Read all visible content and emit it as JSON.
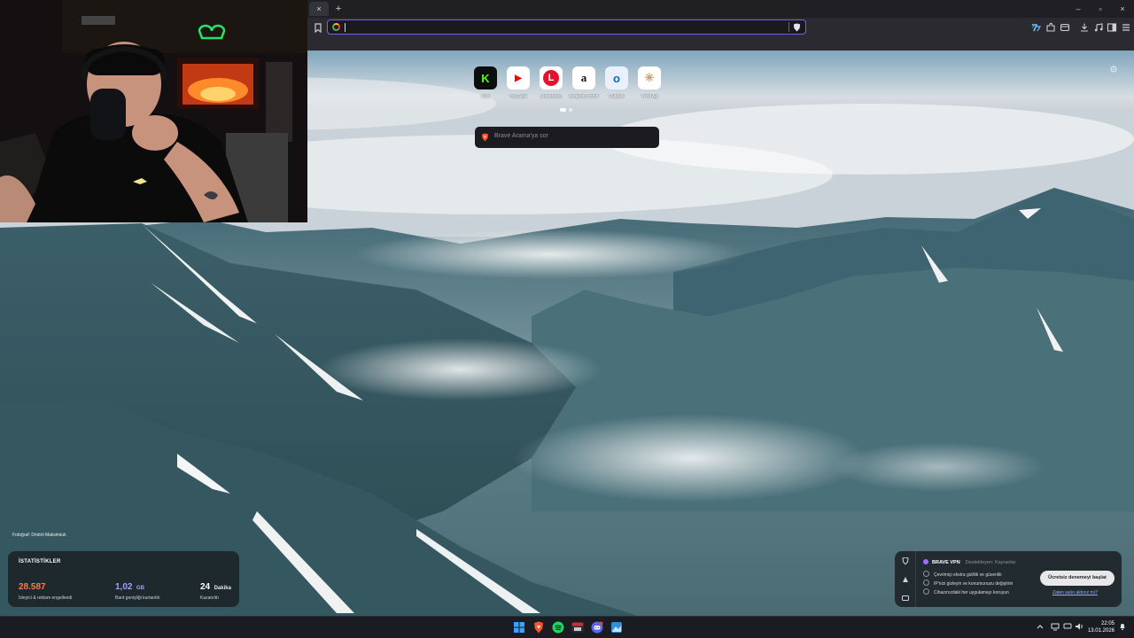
{
  "browser": {
    "tab_close": "×",
    "new_tab": "+",
    "url_value": "",
    "window_controls": [
      "–",
      "▫",
      "×"
    ]
  },
  "ntp": {
    "top_sites": [
      {
        "label": "Kick",
        "glyph": "K",
        "color": "#53fc18",
        "bg": "#0b0e0f"
      },
      {
        "label": "YouTube",
        "glyph": "▶",
        "color": "#ff0000",
        "bg": "#ffffff"
      },
      {
        "label": "Letterboxd",
        "glyph": "L",
        "color": "#ffffff",
        "bg": "#e8102b"
      },
      {
        "label": "Amazon.com.tr",
        "glyph": "a",
        "color": "#111111",
        "bg": "#ffffff"
      },
      {
        "label": "Outlook",
        "glyph": "o",
        "color": "#ffffff",
        "bg": "#0a64d6"
      },
      {
        "label": "Yerel Ağ",
        "glyph": "✳",
        "color": "#c9a46a",
        "bg": "#ffffff"
      }
    ],
    "search_placeholder": "Brave Arama'ya sor",
    "photo_credit": "Fotoğraf: Dmitrii Maksimiuk",
    "stats": {
      "title": "İSTATİSTİKLER",
      "items": [
        {
          "value": "28.587",
          "unit": "",
          "caption": "İzleyici & reklam engellendi",
          "color": "#ff7a45"
        },
        {
          "value": "1,02",
          "unit": "GB",
          "caption": "Bant genişliği kurtarıldı",
          "color": "#9aa4ff"
        },
        {
          "value": "24",
          "unit": "Dakika",
          "caption": "Kazanıldı",
          "color": "#ffffff"
        }
      ]
    },
    "vpn": {
      "title": "BRAVE VPN",
      "powered_by": "Destekleyen: Kayranlar",
      "features": [
        "Çevrimiçi ekstra gizlilik ve güvenlik",
        "IP'nizi gizleyin ve konumunuzu değiştirin",
        "Cihazınızdaki her uygulamayı koruyun"
      ],
      "trial_button": "Ücretsiz denemeyi başlat",
      "purchased_link": "Zaten satın aldınız mı?"
    }
  },
  "taskbar": {
    "apps": [
      {
        "name": "windows-start-icon",
        "color": "#3ba3ff"
      },
      {
        "name": "brave-browser-icon",
        "color": "#fb542b"
      },
      {
        "name": "spotify-icon",
        "color": "#1ed760"
      },
      {
        "name": "streaming-app-icon",
        "color": "#c62f3a"
      },
      {
        "name": "discord-icon",
        "color": "#5865f2"
      },
      {
        "name": "photos-app-icon",
        "color": "#2f8fd8"
      }
    ],
    "time": "22:05",
    "date": "13.01.2026"
  }
}
